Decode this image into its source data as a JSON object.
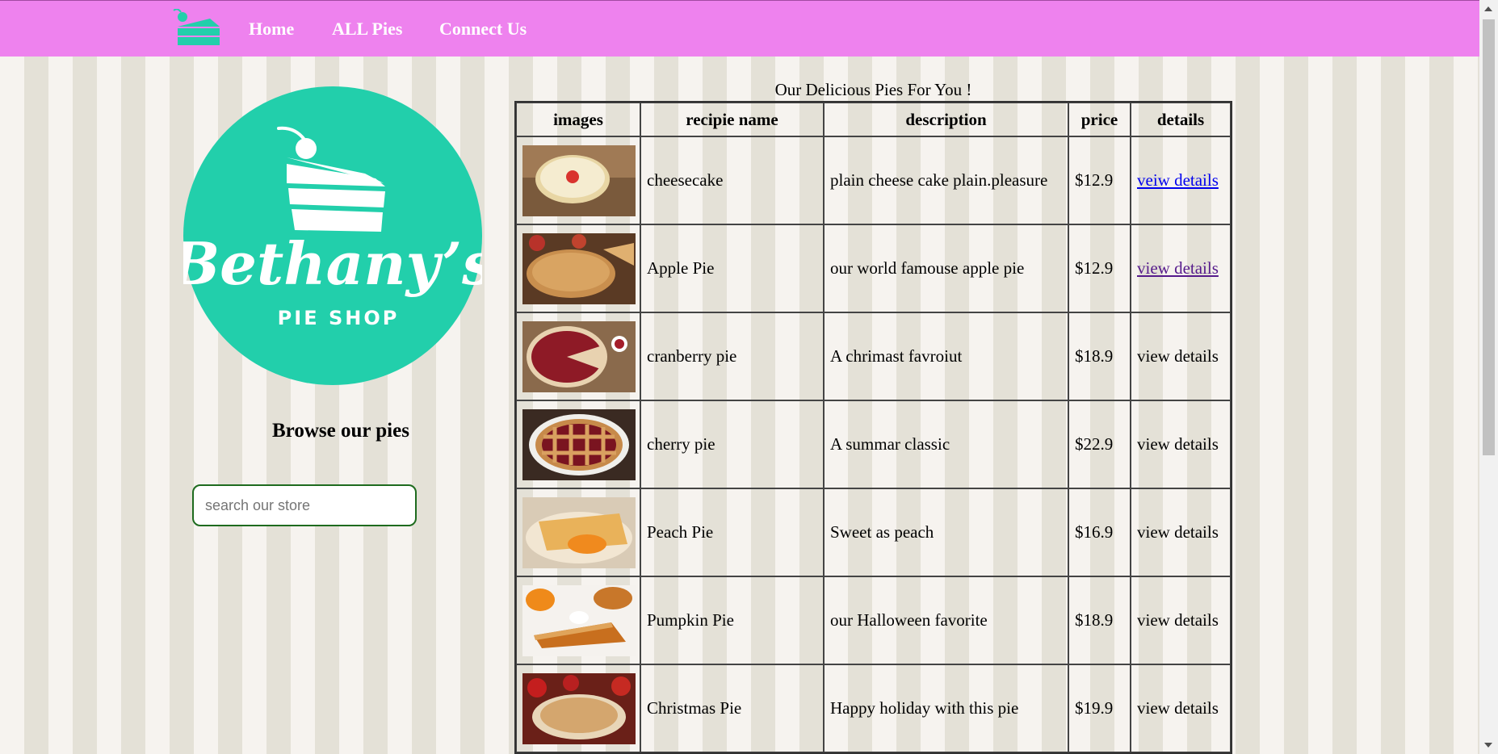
{
  "nav": {
    "logo_icon": "cake-slice-icon",
    "links": [
      {
        "label": "Home"
      },
      {
        "label": "ALL Pies"
      },
      {
        "label": "Connect Us"
      }
    ],
    "background": "#ee82ee"
  },
  "sidebar": {
    "brand_logo": {
      "name": "Bethany’s",
      "subtitle": "PIE SHOP",
      "color": "#22cfab"
    },
    "browse_heading": "Browse our pies",
    "search": {
      "placeholder": "search our store",
      "value": ""
    }
  },
  "table": {
    "caption": "Our Delicious Pies For You !",
    "headers": [
      "images",
      "recipie name",
      "description",
      "price",
      "details"
    ],
    "rows": [
      {
        "image": "cheesecake-image",
        "name": "cheesecake",
        "description": "plain cheese cake plain.pleasure",
        "price": "$12.9",
        "details": "veiw details",
        "details_style": "link"
      },
      {
        "image": "apple-pie-image",
        "name": "Apple Pie",
        "description": "our world famouse apple pie",
        "price": "$12.9",
        "details": "view details",
        "details_style": "visited-link"
      },
      {
        "image": "cranberry-pie-image",
        "name": "cranberry pie",
        "description": "A chrimast favroiut",
        "price": "$18.9",
        "details": "view details",
        "details_style": "plain"
      },
      {
        "image": "cherry-pie-image",
        "name": "cherry pie",
        "description": "A summar classic",
        "price": "$22.9",
        "details": "view details",
        "details_style": "plain"
      },
      {
        "image": "peach-pie-image",
        "name": "Peach Pie",
        "description": "Sweet as peach",
        "price": "$16.9",
        "details": "view details",
        "details_style": "plain"
      },
      {
        "image": "pumpkin-pie-image",
        "name": "Pumpkin Pie",
        "description": "our Halloween favorite",
        "price": "$18.9",
        "details": "view details",
        "details_style": "plain"
      },
      {
        "image": "christmas-pie-image",
        "name": "Christmas Pie",
        "description": "Happy holiday with this pie",
        "price": "$19.9",
        "details": "view details",
        "details_style": "plain"
      }
    ]
  }
}
